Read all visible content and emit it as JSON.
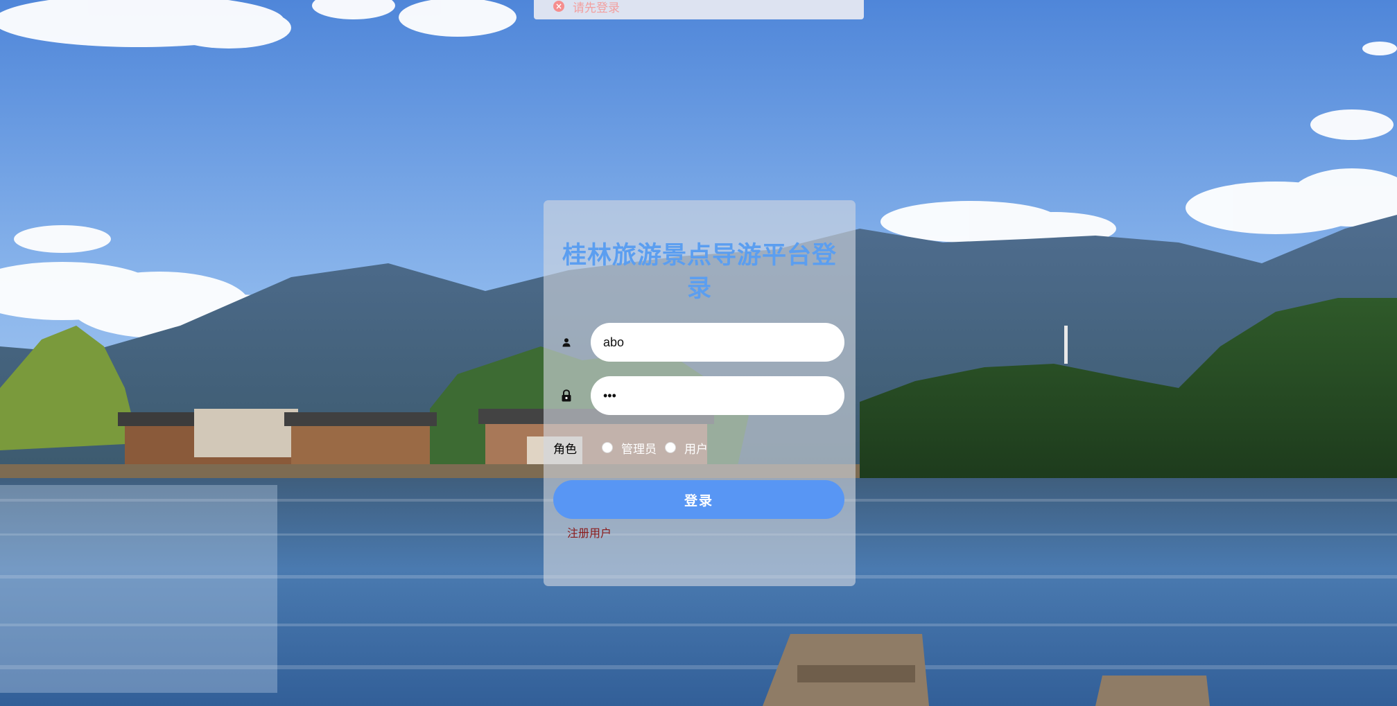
{
  "toast": {
    "message": "请先登录",
    "icon": "error-circle-icon",
    "color": "#f58e8e"
  },
  "login": {
    "title": "桂林旅游景点导游平台登录",
    "username": {
      "icon": "user-icon",
      "value": "abo",
      "placeholder": ""
    },
    "password": {
      "icon": "lock-icon",
      "value": "•••",
      "placeholder": ""
    },
    "role": {
      "label": "角色",
      "options": [
        "管理员",
        "用户"
      ],
      "selected": null
    },
    "submit_label": "登录",
    "register_label": "注册用户"
  },
  "colors": {
    "title": "#5b9ef0",
    "button": "#5896f4",
    "register_link": "#8a1a1a"
  }
}
